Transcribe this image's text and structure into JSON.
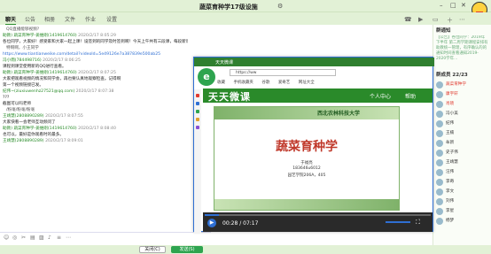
{
  "window": {
    "title": "蔬菜育种学17级设施",
    "tabs": [
      "聊天",
      "公告",
      "相册",
      "文件",
      "作业",
      "设置"
    ],
    "active_tab": "聊天"
  },
  "chat": {
    "messages": [
      {
        "text": "QQ直播能够视频?",
        "type": "quote"
      },
      {
        "who": "助教) 蔬菜育种学-姜维刚(1419614760)",
        "time": "2020/2/17 8:05:29"
      },
      {
        "text": "各位同学，大家好！感受家和大家一起上课！设签到的同学及时签到啊！今天上午共有三段课，每段新课后都会有课堂检查，希望同学们认真观看，检查时间点为：8:20|9:00|9:30"
      },
      {
        "text": "特啊啊，小王同学",
        "type": "quote"
      },
      {
        "text": "https://www.tiantianweike.com/detail?videoId=5e49126e7a387839e500ab25",
        "type": "link"
      },
      {
        "who": "冯小雨(784498716)",
        "time": "2020/2/17 8:06:25"
      },
      {
        "text": "课程到课堂使用新的QQ进行查看。"
      },
      {
        "who": "助教) 蔬菜育种学-姜维刚(1419614760)",
        "time": "2020/2/17 8:07:25"
      },
      {
        "text": "大家把观看视频的情况和同学会，再也要认真地观察检查。记得啊"
      },
      {
        "text": "第一个视频链接已发。"
      },
      {
        "who": "纪伟~(ziuxiuwenhz27521@qq.com)",
        "time": "2020/2/17 8:07:38"
      },
      {
        "text": "???"
      },
      {
        "text": "截图可以吗老师"
      },
      {
        "text": "/粉毫/粉毫/粉毫",
        "type": "quote"
      },
      {
        "who": "王靖慧(2808890289)",
        "time": "2020/2/17 8:07:55"
      },
      {
        "text": "大家快看一会老师互动频问了"
      },
      {
        "who": "助教) 蔬菜育种学-姜维刚(1419614760)",
        "time": "2020/2/17 8:08:40"
      },
      {
        "text": "也可以，最好是你观看时的最多。"
      },
      {
        "who": "王靖慧(2808890289)",
        "time": "2020/2/17 8:09:01"
      }
    ],
    "send_label": "发送(S)",
    "close_label": "关闭(C)"
  },
  "sidebar": {
    "notice_title": "群通知",
    "notice_text": "【公告】各位同学：2019年下半年 第二周学期课程安排有助教统一管理，有序确认的的通知时间查看通知2019-2020学年…",
    "members_title": "群成员 22/23",
    "members": [
      "蔬菜育种学",
      "康宇轩",
      "肖晓",
      "冯小美",
      "纪伟",
      "王楠",
      "牟新",
      "史子伟",
      "王靖慧",
      "汪伟",
      "李奇",
      "李文",
      "刘伟",
      "李星",
      "杨梦"
    ]
  },
  "browser": {
    "tab_title": "天天微课",
    "address": "https://ww",
    "bookmarks": [
      "收藏",
      "手机收藏夹",
      "谷歌",
      "爱奇艺",
      "网址大全"
    ],
    "site_brand": "天天微课",
    "nav": [
      "个人中心",
      "帮助"
    ],
    "slide": {
      "school": "西北农林科技大学",
      "title": "蔬菜育种学",
      "lines": [
        "于福亮",
        "183646u6012",
        "园艺学院206A，405"
      ]
    },
    "video": {
      "current": "00:28",
      "total": "07:17",
      "progress": 0.064
    }
  },
  "colors": {
    "theme": "#e2f1d6",
    "accent": "#2ea44f",
    "link": "#2f6fd3"
  }
}
